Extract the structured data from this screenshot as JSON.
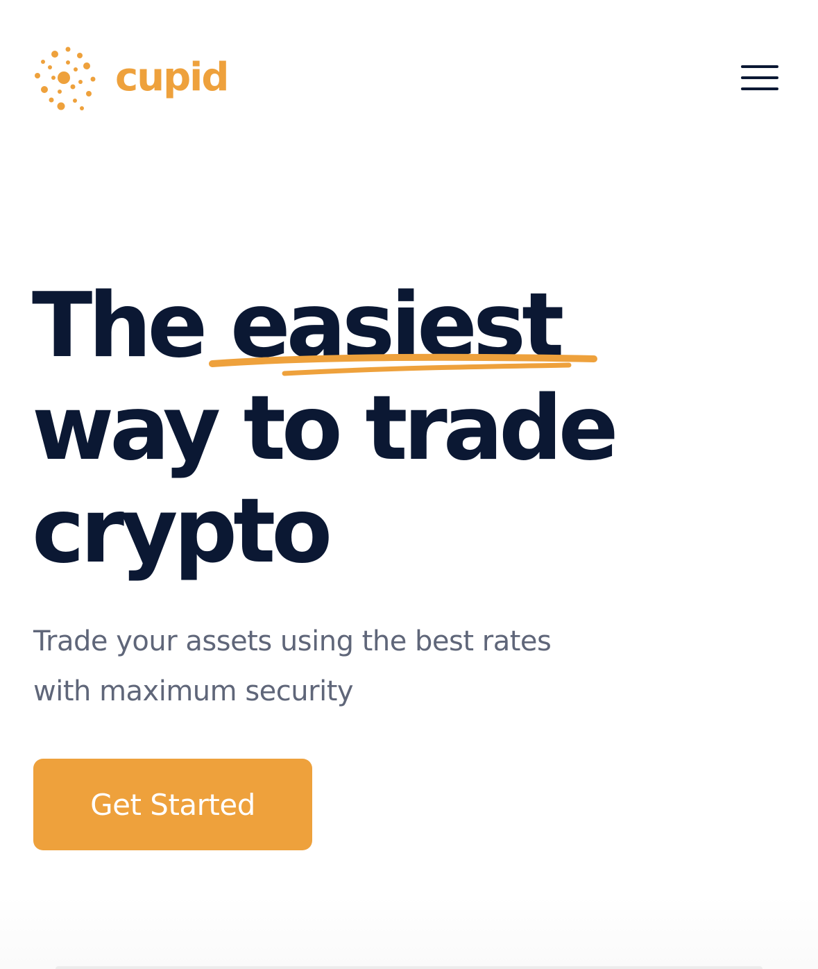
{
  "brand": {
    "name": "cupid",
    "logo_icon": "dotted-circle-logo-icon",
    "color": "#eea13c"
  },
  "header": {
    "menu_icon": "hamburger-menu-icon"
  },
  "hero": {
    "title_line1_prefix": "The ",
    "title_highlight": "easiest",
    "title_line2": "way to trade",
    "title_line3": "crypto",
    "subtitle": "Trade your assets using the best rates with maximum security",
    "cta_label": "Get Started"
  },
  "colors": {
    "accent": "#eea13c",
    "heading": "#0b1833",
    "body_text": "#5f6679",
    "background": "#ffffff"
  }
}
